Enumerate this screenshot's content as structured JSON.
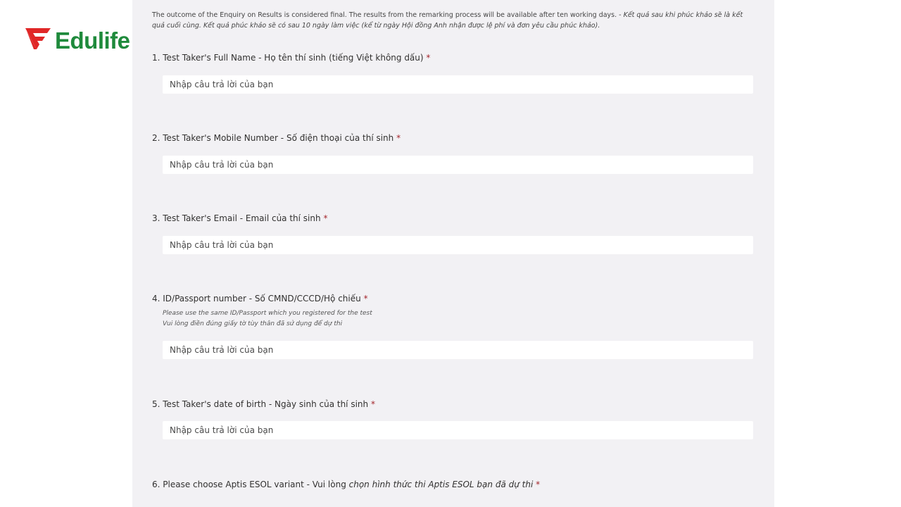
{
  "logo": {
    "text": "Edulife",
    "brand_color": "#1f8a3c",
    "mark_color": "#e02727",
    "icon": "edulife-logo-icon"
  },
  "form": {
    "intro_en": "The outcome of the Enquiry on Results is considered final. The results from the remarking process will be available after ten working days. - ",
    "intro_vi": "Kết quả sau khi phúc khảo sẽ là kết quả cuối cùng. Kết quả phúc khảo sẽ có sau 10 ngày làm việc (kể từ ngày Hội đồng Anh nhận được lệ phí và đơn yêu cầu phúc khảo).",
    "required_mark": "*",
    "questions": [
      {
        "title": "1. Test Taker's Full Name - Họ tên thí sinh (tiếng Việt không dấu)",
        "placeholder": "Nhập câu trả lời của bạn"
      },
      {
        "title": "2. Test Taker's Mobile Number - Số điện thoại của thí sinh",
        "placeholder": "Nhập câu trả lời của bạn"
      },
      {
        "title": "3. Test Taker's Email - Email của thí sinh",
        "placeholder": "Nhập câu trả lời của bạn"
      },
      {
        "title": "4. ID/Passport number - Số CMND/CCCD/Hộ chiếu",
        "subtitle_1": "Please use the same ID/Passport which you registered for the test",
        "subtitle_2": "Vui lòng điền đúng giấy tờ tùy thân đã sử dụng để dự thi",
        "placeholder": "Nhập câu trả lời của bạn"
      },
      {
        "title": "5. Test Taker's date of birth - Ngày sinh của thí sinh",
        "placeholder": "Nhập câu trả lời của bạn"
      },
      {
        "title_plain": "6. Please choose Aptis ESOL variant - Vui lòng ",
        "title_italic": "chọn hình thức thi Aptis ESOL bạn đã dự thi"
      }
    ]
  }
}
